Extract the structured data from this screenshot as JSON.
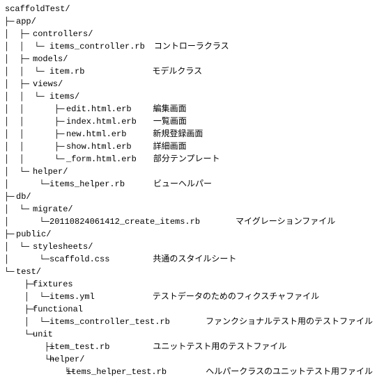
{
  "tree": [
    {
      "guides": "",
      "name": "scaffoldTest/",
      "name_col": 0,
      "desc": "",
      "desc_col": 0
    },
    {
      "guides": "├─",
      "name": "app/",
      "name_col": 16,
      "desc": "",
      "desc_col": 0
    },
    {
      "guides": "│  ├─",
      "name": "controllers/",
      "name_col": 40,
      "desc": "",
      "desc_col": 0
    },
    {
      "guides": "│  │  └─",
      "name": "items_controller.rb",
      "name_col": 64,
      "desc": "コントローラクラス",
      "desc_col": 210
    },
    {
      "guides": "│  ├─",
      "name": "models/",
      "name_col": 40,
      "desc": "",
      "desc_col": 0
    },
    {
      "guides": "│  │  └─",
      "name": "item.rb",
      "name_col": 64,
      "desc": "モデルクラス",
      "desc_col": 210
    },
    {
      "guides": "│  ├─",
      "name": "views/",
      "name_col": 40,
      "desc": "",
      "desc_col": 0
    },
    {
      "guides": "│  │  └─",
      "name": "items/",
      "name_col": 64,
      "desc": "",
      "desc_col": 0
    },
    {
      "guides": "│  │      ├─",
      "name": "edit.html.erb",
      "name_col": 88,
      "desc": "編集画面",
      "desc_col": 210
    },
    {
      "guides": "│  │      ├─",
      "name": "index.html.erb",
      "name_col": 88,
      "desc": "一覧画面",
      "desc_col": 210
    },
    {
      "guides": "│  │      ├─",
      "name": "new.html.erb",
      "name_col": 88,
      "desc": "新規登録画面",
      "desc_col": 210
    },
    {
      "guides": "│  │      ├─",
      "name": "show.html.erb",
      "name_col": 88,
      "desc": "詳細画面",
      "desc_col": 210
    },
    {
      "guides": "│  │      └─",
      "name": "_form.html.erb",
      "name_col": 88,
      "desc": "部分テンプレート",
      "desc_col": 210
    },
    {
      "guides": "│  └─",
      "name": "helper/",
      "name_col": 40,
      "desc": "",
      "desc_col": 0
    },
    {
      "guides": "│      └─",
      "name": "items_helper.rb",
      "name_col": 64,
      "desc": "ビューヘルパー",
      "desc_col": 210
    },
    {
      "guides": "├─",
      "name": "db/",
      "name_col": 16,
      "desc": "",
      "desc_col": 0
    },
    {
      "guides": "│  └─",
      "name": "migrate/",
      "name_col": 40,
      "desc": "",
      "desc_col": 0
    },
    {
      "guides": "│      └─",
      "name": "20110824061412_create_items.rb",
      "name_col": 64,
      "desc": "マイグレーションファイル",
      "desc_col": 325
    },
    {
      "guides": "├─",
      "name": "public/",
      "name_col": 16,
      "desc": "",
      "desc_col": 0
    },
    {
      "guides": "│  └─",
      "name": "stylesheets/",
      "name_col": 40,
      "desc": "",
      "desc_col": 0
    },
    {
      "guides": "│      └─",
      "name": "scaffold.css",
      "name_col": 64,
      "desc": "共通のスタイルシート",
      "desc_col": 210
    },
    {
      "guides": "└─",
      "name": "test/",
      "name_col": 16,
      "desc": "",
      "desc_col": 0
    },
    {
      "guides": "    ├─",
      "name": "fixtures",
      "name_col": 40,
      "desc": "",
      "desc_col": 0
    },
    {
      "guides": "    │  └─",
      "name": "items.yml",
      "name_col": 64,
      "desc": "テストデータのためのフィクスチャファイル",
      "desc_col": 210
    },
    {
      "guides": "    ├─",
      "name": "functional",
      "name_col": 40,
      "desc": "",
      "desc_col": 0
    },
    {
      "guides": "    │  └─",
      "name": "items_controller_test.rb",
      "name_col": 64,
      "desc": "ファンクショナルテスト用のテストファイル",
      "desc_col": 285
    },
    {
      "guides": "    └─",
      "name": "unit",
      "name_col": 40,
      "desc": "",
      "desc_col": 0
    },
    {
      "guides": "        ├─",
      "name": "item_test.rb",
      "name_col": 64,
      "desc": "ユニットテスト用のテストファイル",
      "desc_col": 210
    },
    {
      "guides": "        └─",
      "name": "helper/",
      "name_col": 64,
      "desc": "",
      "desc_col": 0
    },
    {
      "guides": "            └─",
      "name": "items_helper_test.rb",
      "name_col": 88,
      "desc": "ヘルパークラスのユニットテスト用ファイル",
      "desc_col": 285
    }
  ]
}
